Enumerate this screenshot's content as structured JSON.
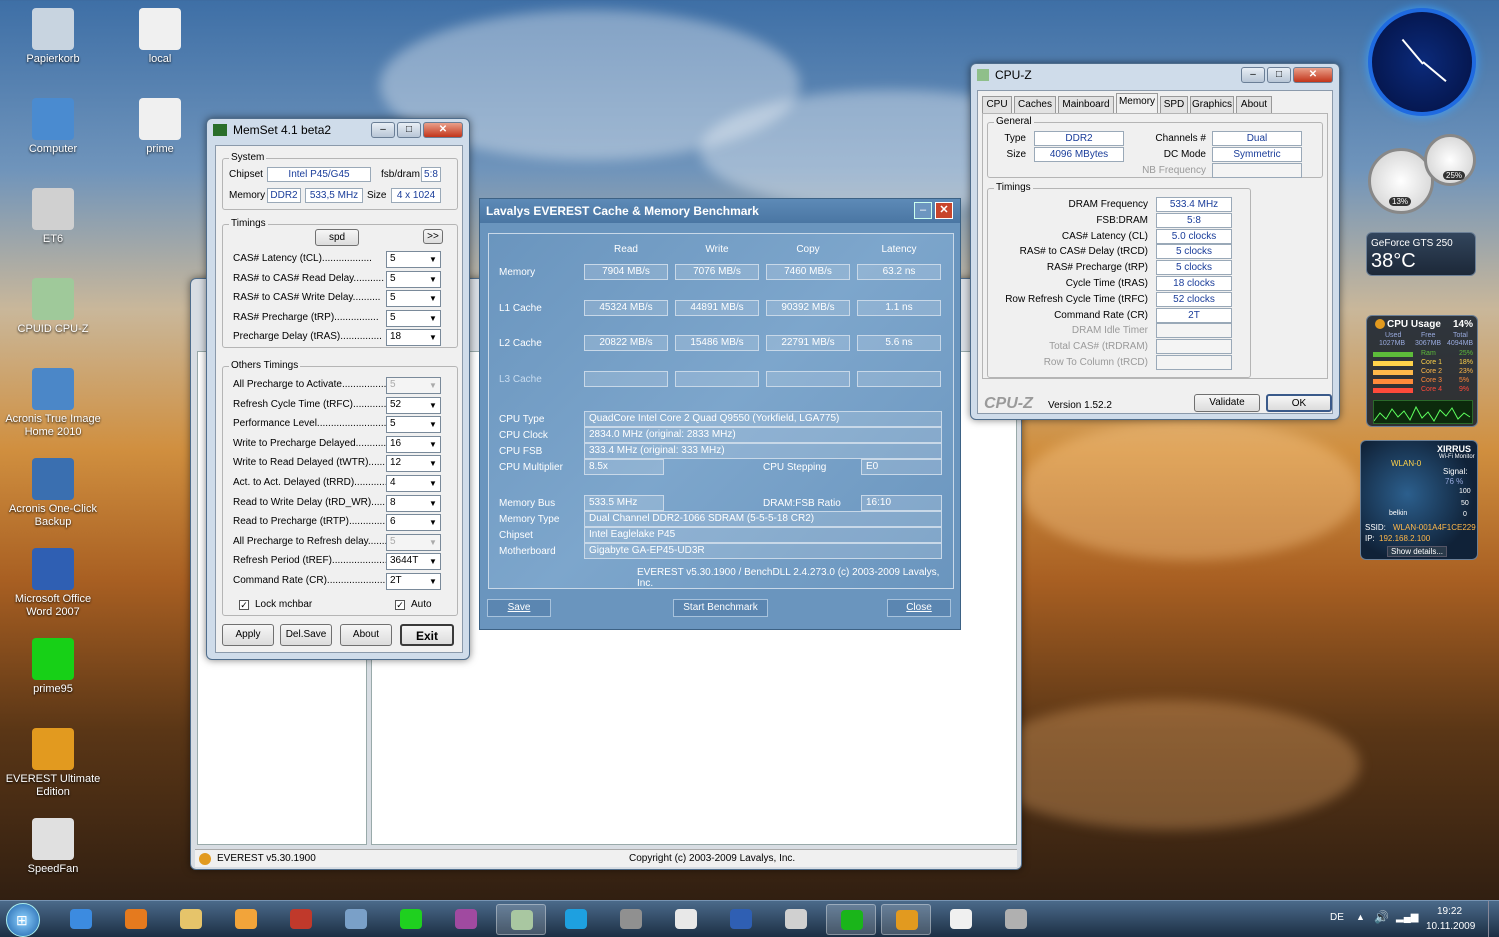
{
  "desktop": {
    "icons": [
      {
        "label": "Papierkorb",
        "color": "#c8d4e0"
      },
      {
        "label": "local",
        "color": "#f0f0f0"
      },
      {
        "label": "Computer",
        "color": "#4a8bd0"
      },
      {
        "label": "prime",
        "color": "#f0f0f0"
      },
      {
        "label": "ET6",
        "color": "#d0d0d0"
      },
      {
        "label": "CPUID CPU-Z",
        "color": "#9fc99a"
      },
      {
        "label": "Acronis True Image Home 2010",
        "color": "#4b87c8"
      },
      {
        "label": "Acronis One-Click Backup",
        "color": "#3a6fb0"
      },
      {
        "label": "Microsoft Office Word 2007",
        "color": "#2f5fb3"
      },
      {
        "label": "prime95",
        "color": "#17d017"
      },
      {
        "label": "EVEREST Ultimate Edition",
        "color": "#e29a1f"
      },
      {
        "label": "SpeedFan",
        "color": "#e0e0e0"
      }
    ]
  },
  "memset": {
    "title": "MemSet 4.1 beta2",
    "system_label": "System",
    "chipset_label": "Chipset",
    "chipset": "Intel P45/G45",
    "fsbdram_label": "fsb/dram",
    "fsbdram": "5:8",
    "memory_label": "Memory",
    "memory_type": "DDR2",
    "memory_freq": "533,5 MHz",
    "size_label": "Size",
    "size": "4 x 1024",
    "timings_label": "Timings",
    "spd_button": "spd",
    "more_button": ">>",
    "timings": [
      {
        "label": "CAS# Latency (tCL)..................",
        "value": "5"
      },
      {
        "label": "RAS# to CAS# Read Delay...........",
        "value": "5"
      },
      {
        "label": "RAS# to CAS# Write Delay..........",
        "value": "5"
      },
      {
        "label": "RAS# Precharge (tRP)................",
        "value": "5"
      },
      {
        "label": "Precharge Delay  (tRAS)...............",
        "value": "18"
      }
    ],
    "other_label": "Others Timings",
    "other": [
      {
        "label": "All Precharge to Activate..................",
        "value": "5",
        "disabled": true
      },
      {
        "label": "Refresh Cycle Time (tRFC)..............",
        "value": "52"
      },
      {
        "label": "Performance Level...........................",
        "value": "5"
      },
      {
        "label": "Write to Precharge Delayed................",
        "value": "16"
      },
      {
        "label": "Write to Read Delayed (tWTR)............",
        "value": "12"
      },
      {
        "label": "Act. to Act. Delayed (tRRD)................",
        "value": "4"
      },
      {
        "label": "Read to Write Delay (tRD_WR)............",
        "value": "8"
      },
      {
        "label": "Read to Precharge (tRTP)...................",
        "value": "6"
      },
      {
        "label": "All Precharge to Refresh delay.............",
        "value": "5",
        "disabled": true
      },
      {
        "label": "Refresh Period (tREF)......................",
        "value": "3644T"
      },
      {
        "label": "Command Rate (CR)..........................",
        "value": "2T"
      }
    ],
    "lock_label": "Lock mchbar",
    "auto_label": "Auto",
    "buttons": [
      "Apply",
      "Del.Save",
      "About",
      "Exit"
    ]
  },
  "cpuz": {
    "title": "CPU-Z",
    "tabs": [
      "CPU",
      "Caches",
      "Mainboard",
      "Memory",
      "SPD",
      "Graphics",
      "About"
    ],
    "active_tab": "Memory",
    "general_label": "General",
    "type_label": "Type",
    "type": "DDR2",
    "size_label": "Size",
    "size": "4096 MBytes",
    "channels_label": "Channels #",
    "channels": "Dual",
    "dcmode_label": "DC Mode",
    "dcmode": "Symmetric",
    "nbfreq_label": "NB Frequency",
    "timings_label": "Timings",
    "timings": [
      {
        "label": "DRAM Frequency",
        "value": "533.4 MHz"
      },
      {
        "label": "FSB:DRAM",
        "value": "5:8"
      },
      {
        "label": "CAS# Latency (CL)",
        "value": "5.0 clocks"
      },
      {
        "label": "RAS# to CAS# Delay (tRCD)",
        "value": "5 clocks"
      },
      {
        "label": "RAS# Precharge (tRP)",
        "value": "5 clocks"
      },
      {
        "label": "Cycle Time (tRAS)",
        "value": "18 clocks"
      },
      {
        "label": "Row Refresh Cycle Time (tRFC)",
        "value": "52 clocks"
      },
      {
        "label": "Command Rate (CR)",
        "value": "2T"
      },
      {
        "label": "DRAM Idle Timer",
        "value": "",
        "dim": true
      },
      {
        "label": "Total CAS# (tRDRAM)",
        "value": "",
        "dim": true
      },
      {
        "label": "Row To Column (tRCD)",
        "value": "",
        "dim": true
      }
    ],
    "brand": "CPU-Z",
    "version": "Version 1.52.2",
    "validate": "Validate",
    "ok": "OK"
  },
  "everest": {
    "title": "Lavalys EVEREST Cache & Memory Benchmark",
    "headers": [
      "Read",
      "Write",
      "Copy",
      "Latency"
    ],
    "rows": [
      {
        "label": "Memory",
        "values": [
          "7904 MB/s",
          "7076 MB/s",
          "7460 MB/s",
          "63.2 ns"
        ]
      },
      {
        "label": "L1 Cache",
        "values": [
          "45324 MB/s",
          "44891 MB/s",
          "90392 MB/s",
          "1.1 ns"
        ]
      },
      {
        "label": "L2 Cache",
        "values": [
          "20822 MB/s",
          "15486 MB/s",
          "22791 MB/s",
          "5.6 ns"
        ]
      },
      {
        "label": "L3 Cache",
        "values": [
          "",
          "",
          "",
          ""
        ]
      }
    ],
    "cpu_type_label": "CPU Type",
    "cpu_type": "QuadCore Intel Core 2 Quad Q9550  (Yorkfield, LGA775)",
    "cpu_clock_label": "CPU Clock",
    "cpu_clock": "2834.0 MHz  (original: 2833 MHz)",
    "cpu_fsb_label": "CPU FSB",
    "cpu_fsb": "333.4 MHz  (original: 333 MHz)",
    "cpu_mult_label": "CPU Multiplier",
    "cpu_mult": "8.5x",
    "cpu_step_label": "CPU Stepping",
    "cpu_step": "E0",
    "mem_bus_label": "Memory Bus",
    "mem_bus": "533.5 MHz",
    "dram_fsb_label": "DRAM:FSB Ratio",
    "dram_fsb": "16:10",
    "mem_type_label": "Memory Type",
    "mem_type": "Dual Channel DDR2-1066 SDRAM  (5-5-5-18 CR2)",
    "chipset_label": "Chipset",
    "chipset": "Intel Eaglelake P45",
    "mobo_label": "Motherboard",
    "mobo": "Gigabyte GA-EP45-UD3R",
    "footer": "EVEREST v5.30.1900 / BenchDLL 2.4.273.0  (c) 2003-2009 Lavalys, Inc.",
    "save": "Save",
    "start": "Start Benchmark",
    "close": "Close"
  },
  "everest_main": {
    "status_left": "EVEREST v5.30.1900",
    "status_right": "Copyright (c) 2003-2009 Lavalys, Inc."
  },
  "gadgets": {
    "gpu_name": "GeForce GTS 250",
    "gpu_temp": "38°C",
    "cpu_usage_label": "CPU Usage",
    "cpu_usage": "14%",
    "cpu_cols": [
      "Used",
      "Free",
      "Total"
    ],
    "cpu_vals": [
      "1027MB",
      "3067MB",
      "4094MB"
    ],
    "cpu_rows": [
      {
        "label": "Ram",
        "value": "25%"
      },
      {
        "label": "Core 1",
        "value": "18%"
      },
      {
        "label": "Core 2",
        "value": "23%"
      },
      {
        "label": "Core 3",
        "value": "5%"
      },
      {
        "label": "Core 4",
        "value": "9%"
      }
    ],
    "gauge1": "13%",
    "gauge2": "25%",
    "wlan_brand": "XIRRUS",
    "wlan_sub": "Wi-Fi Monitor",
    "wlan_signal_label": "Signal:",
    "wlan_signal": "76 %",
    "wlan_ssid_label": "SSID:",
    "wlan_ssid": "WLAN-001A4F1CE229",
    "wlan_ip_label": "IP:",
    "wlan_ip": "192.168.2.100",
    "wlan_net": "WLAN-0",
    "wlan_belkin": "belkin",
    "wlan_scale": [
      "100",
      "50",
      "0"
    ],
    "wlan_details": "Show details..."
  },
  "taskbar": {
    "lang": "DE",
    "time": "19:22",
    "date": "10.11.2009",
    "items": [
      {
        "name": "ie",
        "color": "#3c8be0"
      },
      {
        "name": "firefox",
        "color": "#e57a1e"
      },
      {
        "name": "explorer",
        "color": "#e6c46a"
      },
      {
        "name": "media",
        "color": "#f2a43a"
      },
      {
        "name": "tool1",
        "color": "#c0392b"
      },
      {
        "name": "tool2",
        "color": "#7aa0c8"
      },
      {
        "name": "prime95",
        "color": "#1fd01f"
      },
      {
        "name": "winrar",
        "color": "#a04aa0"
      },
      {
        "name": "cpuz",
        "color": "#a9c7a1",
        "active": true
      },
      {
        "name": "skype",
        "color": "#1ea0e0"
      },
      {
        "name": "tool3",
        "color": "#909090"
      },
      {
        "name": "notepad",
        "color": "#e8e8e8"
      },
      {
        "name": "word",
        "color": "#2f5fb3"
      },
      {
        "name": "et6",
        "color": "#d0d0d0"
      },
      {
        "name": "memset",
        "color": "#1ab51a",
        "active": true
      },
      {
        "name": "everest",
        "color": "#e29a1f",
        "active": true
      },
      {
        "name": "doc",
        "color": "#f0f0f0"
      },
      {
        "name": "net",
        "color": "#b0b0b0"
      }
    ]
  }
}
